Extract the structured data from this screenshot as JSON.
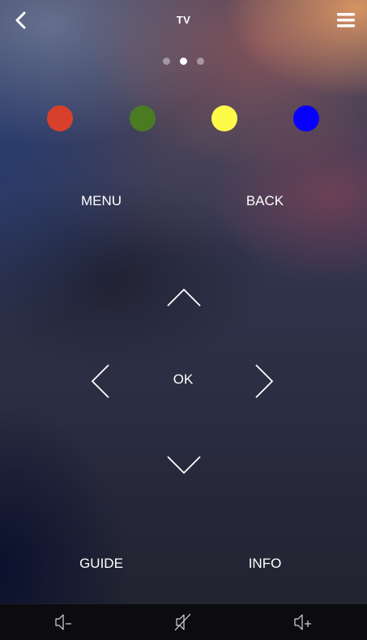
{
  "header": {
    "title": "TV",
    "back_icon": "chevron-left-icon",
    "menu_icon": "hamburger-menu-icon"
  },
  "pager": {
    "page_count": 3,
    "active_page": 2
  },
  "color_buttons": [
    {
      "name": "red",
      "color": "#d9402b"
    },
    {
      "name": "green",
      "color": "#4a7a22"
    },
    {
      "name": "yellow",
      "color": "#fefa4a"
    },
    {
      "name": "blue",
      "color": "#0800ff"
    }
  ],
  "controls": {
    "menu_label": "MENU",
    "back_label": "BACK",
    "ok_label": "OK",
    "guide_label": "GUIDE",
    "info_label": "INFO"
  },
  "dpad_icons": {
    "up": "chevron-up-icon",
    "down": "chevron-down-icon",
    "left": "chevron-left-icon",
    "right": "chevron-right-icon"
  },
  "volume_bar": {
    "volume_down_icon": "volume-down-icon",
    "mute_icon": "mute-icon",
    "volume_up_icon": "volume-up-icon"
  }
}
